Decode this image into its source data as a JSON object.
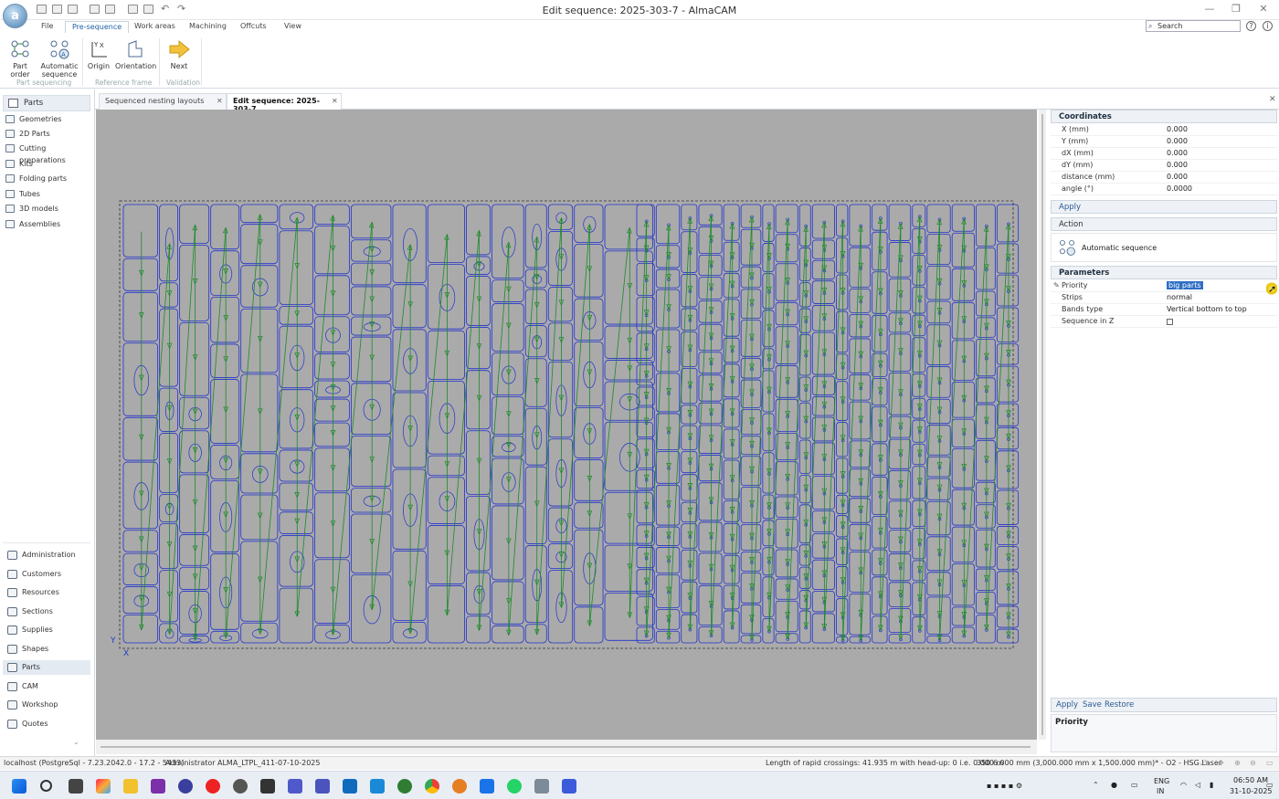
{
  "app": {
    "title": "Edit sequence: 2025-303-7 - AlmaCAM",
    "logo_letter": "a"
  },
  "ribbon_tabs": [
    "File",
    "Pre-sequence",
    "Work areas",
    "Machining",
    "Offcuts",
    "View"
  ],
  "search": {
    "placeholder": "Search"
  },
  "ribbon": {
    "buttons": [
      "Part order",
      "Automatic\nsequence",
      "Origin",
      "Orientation",
      "Next"
    ],
    "groups": [
      "Part sequencing",
      "Reference frame",
      "Validation"
    ]
  },
  "sidebar": {
    "header": "Parts",
    "items": [
      "Geometries",
      "2D Parts",
      "Cutting preparations",
      "Kits",
      "Folding parts",
      "Tubes",
      "3D models",
      "Assemblies"
    ],
    "nav": [
      "Administration",
      "Customers",
      "Resources",
      "Sections",
      "Supplies",
      "Shapes",
      "Parts",
      "CAM",
      "Workshop",
      "Quotes"
    ]
  },
  "doc_tabs": [
    "Sequenced nesting layouts",
    "Edit sequence: 2025-303-7"
  ],
  "canvas": {
    "axis_y": "Y",
    "axis_x": "X"
  },
  "props": {
    "coordinates": {
      "title": "Coordinates",
      "rows": [
        {
          "k": "X (mm)",
          "v": "0.000"
        },
        {
          "k": "Y (mm)",
          "v": "0.000"
        },
        {
          "k": "dX (mm)",
          "v": "0.000"
        },
        {
          "k": "dY (mm)",
          "v": "0.000"
        },
        {
          "k": "distance (mm)",
          "v": "0.000"
        },
        {
          "k": "angle (°)",
          "v": "0.0000"
        }
      ]
    },
    "apply": "Apply",
    "action_title": "Action",
    "action_item": "Automatic sequence",
    "parameters": {
      "title": "Parameters",
      "rows": [
        {
          "k": "Priority",
          "v": "big parts"
        },
        {
          "k": "Strips",
          "v": "normal"
        },
        {
          "k": "Bands type",
          "v": "Vertical bottom to top"
        },
        {
          "k": "Sequence in Z",
          "v": ""
        }
      ]
    },
    "footer_buttons": [
      "Apply",
      "Save",
      "Restore"
    ],
    "description_title": "Priority"
  },
  "status": {
    "db": "localhost (PostgreSql - 7.23.2042.0 - 17.2 - 5433)",
    "user": "Administrator",
    "project": "ALMA_LTPL_411-07-10-2025",
    "rapid": "Length of rapid crossings: 41.935 m  with head-up: 0  i.e. 0.000 m",
    "sheet": "350 6.000 mm (3,000.000 mm x 1,500.000 mm)* - O2 - HSG Laser"
  },
  "taskbar": {
    "lang": "ENG",
    "region": "IN",
    "time": "06:50 AM",
    "date": "31-10-2025"
  }
}
